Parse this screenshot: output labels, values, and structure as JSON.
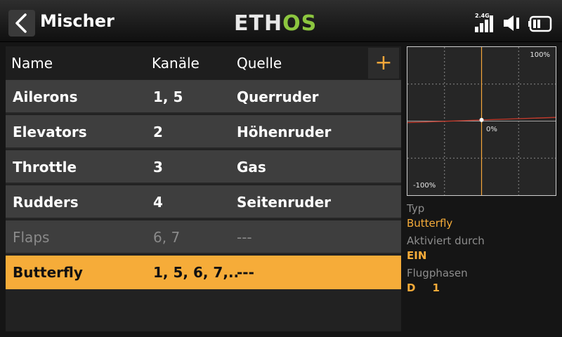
{
  "header": {
    "title": "Mischer",
    "logo_main": "ETH",
    "logo_accent": "OS",
    "signal_label": "2.4G"
  },
  "table": {
    "columns": {
      "name": "Name",
      "channels": "Kanäle",
      "source": "Quelle"
    },
    "add_label": "+",
    "rows": [
      {
        "name": "Ailerons",
        "channels": "1, 5",
        "source": "Querruder",
        "state": "normal"
      },
      {
        "name": "Elevators",
        "channels": "2",
        "source": "Höhenruder",
        "state": "normal"
      },
      {
        "name": "Throttle",
        "channels": "3",
        "source": "Gas",
        "state": "normal"
      },
      {
        "name": "Rudders",
        "channels": "4",
        "source": "Seitenruder",
        "state": "normal"
      },
      {
        "name": "Flaps",
        "channels": "6, 7",
        "source": "---",
        "state": "disabled"
      },
      {
        "name": "Butterfly",
        "channels": "1, 5, 6, 7,...",
        "source": "---",
        "state": "selected"
      }
    ]
  },
  "graph": {
    "label_top": "100%",
    "label_mid": "0%",
    "label_bottom": "-100%",
    "curve_color": "#c0392b",
    "cursor_color": "#f6a73a",
    "output_start": -2,
    "output_end": 5
  },
  "info": {
    "type_label": "Typ",
    "type_value": "Butterfly",
    "active_label": "Aktiviert durch",
    "active_value": "EIN",
    "phases_label": "Flugphasen",
    "phase_letter": "D",
    "phase_number": "1"
  },
  "colors": {
    "accent": "#f6ac39",
    "logo_green": "#8cc63f"
  }
}
